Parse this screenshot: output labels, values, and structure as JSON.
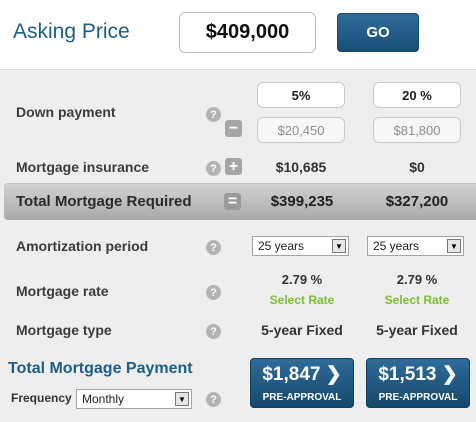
{
  "asking_price": {
    "label": "Asking Price",
    "value": "$409,000",
    "go_label": "GO"
  },
  "help_icon": "?",
  "minus_glyph": "−",
  "plus_glyph": "+",
  "equals_glyph": "=",
  "down_payment": {
    "label": "Down payment",
    "col1": {
      "percent": "5%",
      "amount": "$20,450"
    },
    "col2": {
      "percent": "20 %",
      "amount": "$81,800"
    }
  },
  "mortgage_insurance": {
    "label": "Mortgage insurance",
    "col1": "$10,685",
    "col2": "$0"
  },
  "total_mortgage": {
    "label": "Total Mortgage Required",
    "col1": "$399,235",
    "col2": "$327,200"
  },
  "amortization": {
    "label": "Amortization period",
    "col1": "25 years",
    "col2": "25 years"
  },
  "mortgage_rate": {
    "label": "Mortgage rate",
    "col1": "2.79 %",
    "col2": "2.79 %",
    "select_label": "Select Rate"
  },
  "mortgage_type": {
    "label": "Mortgage type",
    "col1": "5-year Fixed",
    "col2": "5-year Fixed"
  },
  "total_payment": {
    "label": "Total Mortgage Payment",
    "frequency_label": "Frequency",
    "frequency_value": "Monthly",
    "col1": "$1,847 ❯",
    "col2": "$1,513 ❯",
    "button_sub": "PRE-APPROVAL"
  },
  "colors": {
    "brand_blue": "#1a5f86",
    "button_blue": "#174e77",
    "select_rate_green": "#79c12e"
  }
}
